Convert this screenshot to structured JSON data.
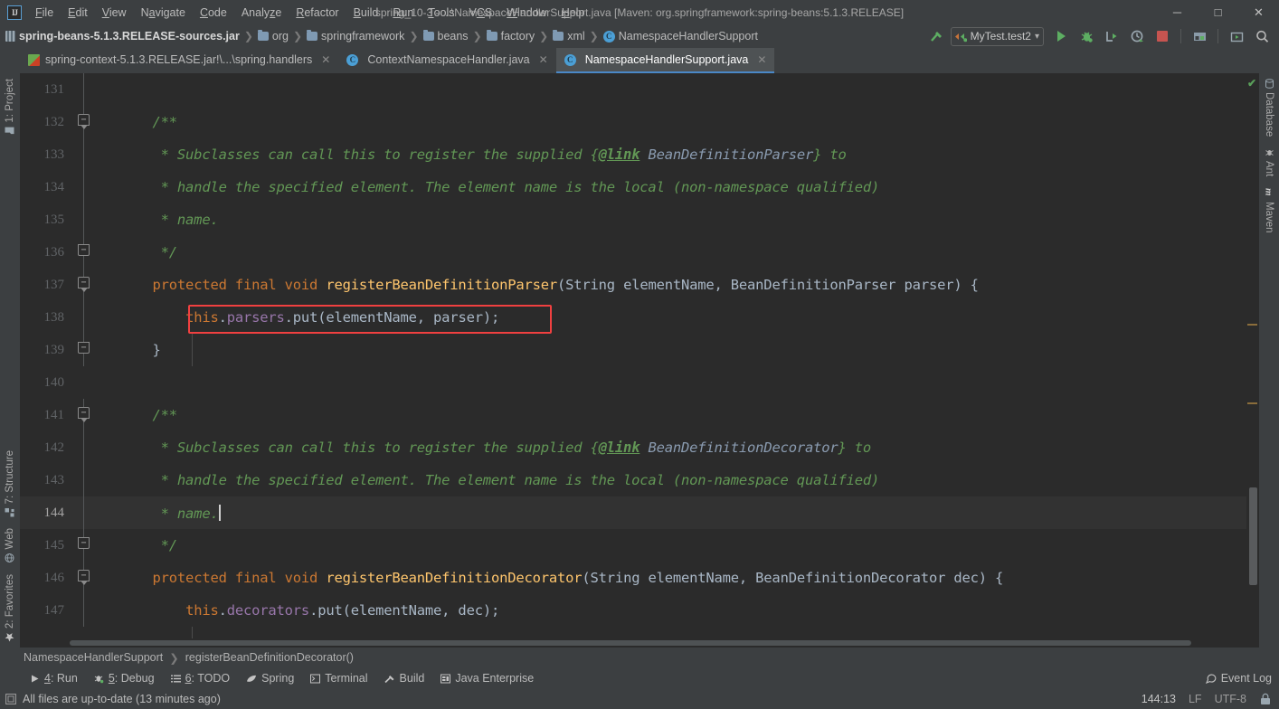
{
  "window": {
    "title": "spring_10-3 - ...\\NamespaceHandlerSupport.java [Maven: org.springframework:spring-beans:5.1.3.RELEASE]",
    "logo": "IJ",
    "minimize": "─",
    "maximize": "□",
    "close": "✕"
  },
  "menu": [
    {
      "label": "File"
    },
    {
      "label": "Edit"
    },
    {
      "label": "View"
    },
    {
      "label": "Navigate"
    },
    {
      "label": "Code"
    },
    {
      "label": "Analyze"
    },
    {
      "label": "Refactor"
    },
    {
      "label": "Build"
    },
    {
      "label": "Run"
    },
    {
      "label": "Tools"
    },
    {
      "label": "VCS"
    },
    {
      "label": "Window"
    },
    {
      "label": "Help"
    }
  ],
  "breadcrumb_top": [
    {
      "label": "spring-beans-5.1.3.RELEASE-sources.jar",
      "icon": "jar-icon"
    },
    {
      "label": "org",
      "icon": "folder-icon"
    },
    {
      "label": "springframework",
      "icon": "folder-icon"
    },
    {
      "label": "beans",
      "icon": "folder-icon"
    },
    {
      "label": "factory",
      "icon": "folder-icon"
    },
    {
      "label": "xml",
      "icon": "folder-icon"
    },
    {
      "label": "NamespaceHandlerSupport",
      "icon": "class-icon",
      "glyph": "C"
    }
  ],
  "toolbar_right": {
    "run_config": "MyTest.test2",
    "dropdown_glyph": "▾",
    "buttons": [
      {
        "name": "build-hammer-button"
      },
      {
        "name": "run-button"
      },
      {
        "name": "debug-button"
      },
      {
        "name": "run-with-coverage-button"
      },
      {
        "name": "profile-button"
      },
      {
        "name": "stop-button"
      },
      {
        "name": "project-structure-button"
      },
      {
        "name": "select-opened-file-button"
      },
      {
        "name": "search-everywhere-button"
      }
    ]
  },
  "tabs": [
    {
      "label": "spring-context-5.1.3.RELEASE.jar!\\...\\spring.handlers",
      "icon": "xml-file-icon",
      "active": false,
      "close": "✕"
    },
    {
      "label": "ContextNamespaceHandler.java",
      "icon": "class-icon",
      "glyph": "C",
      "active": false,
      "close": "✕"
    },
    {
      "label": "NamespaceHandlerSupport.java",
      "icon": "class-icon",
      "glyph": "C",
      "active": true,
      "close": "✕"
    }
  ],
  "left_bar": {
    "top": [
      {
        "label": "1: Project",
        "icon": "project-folder-icon"
      }
    ],
    "bottom": [
      {
        "label": "7: Structure",
        "icon": "structure-icon"
      },
      {
        "label": "Web",
        "icon": "web-globe-icon"
      },
      {
        "label": "2: Favorites",
        "icon": "star-icon"
      }
    ]
  },
  "right_bar": [
    {
      "label": "Database",
      "icon": "database-icon"
    },
    {
      "label": "Ant",
      "icon": "ant-icon"
    },
    {
      "label": "Maven",
      "icon": "maven-icon"
    }
  ],
  "editor": {
    "first_line": 131,
    "current_line": 144,
    "lines": [
      {
        "n": 131,
        "fold": "line",
        "tokens": []
      },
      {
        "n": 132,
        "fold": "top",
        "tokens": [
          {
            "t": "    ",
            "c": "txt"
          },
          {
            "t": "/**",
            "c": "cmt"
          }
        ]
      },
      {
        "n": 133,
        "fold": "line",
        "tokens": [
          {
            "t": "     * Subclasses can call this to register the supplied ",
            "c": "cmt"
          },
          {
            "t": "{",
            "c": "cmt"
          },
          {
            "t": "@link",
            "c": "lnk"
          },
          {
            "t": " ",
            "c": "cmt"
          },
          {
            "t": "BeanDefinitionParser",
            "c": "lnktgt"
          },
          {
            "t": "}",
            "c": "cmt"
          },
          {
            "t": " to",
            "c": "cmt"
          }
        ]
      },
      {
        "n": 134,
        "fold": "line",
        "tokens": [
          {
            "t": "     * handle the specified element. The element name is the local (non-namespace qualified)",
            "c": "cmt"
          }
        ]
      },
      {
        "n": 135,
        "fold": "line",
        "tokens": [
          {
            "t": "     * name.",
            "c": "cmt"
          }
        ]
      },
      {
        "n": 136,
        "fold": "bot",
        "tokens": [
          {
            "t": "     */",
            "c": "cmt"
          }
        ]
      },
      {
        "n": 137,
        "fold": "top",
        "tokens": [
          {
            "t": "    ",
            "c": "txt"
          },
          {
            "t": "protected final void ",
            "c": "kw"
          },
          {
            "t": "registerBeanDefinitionParser",
            "c": "mname"
          },
          {
            "t": "(String elementName, BeanDefinitionParser parser) {",
            "c": "txt"
          }
        ]
      },
      {
        "n": 138,
        "fold": "line",
        "tokens": [
          {
            "t": "        ",
            "c": "txt"
          },
          {
            "t": "this",
            "c": "kw"
          },
          {
            "t": ".",
            "c": "txt"
          },
          {
            "t": "parsers",
            "c": "fld"
          },
          {
            "t": ".put(elementName, parser);",
            "c": "txt"
          }
        ]
      },
      {
        "n": 139,
        "fold": "bot",
        "tokens": [
          {
            "t": "    }",
            "c": "txt"
          }
        ]
      },
      {
        "n": 140,
        "fold": "none",
        "tokens": []
      },
      {
        "n": 141,
        "fold": "top",
        "tokens": [
          {
            "t": "    ",
            "c": "txt"
          },
          {
            "t": "/**",
            "c": "cmt"
          }
        ]
      },
      {
        "n": 142,
        "fold": "line",
        "tokens": [
          {
            "t": "     * Subclasses can call this to register the supplied ",
            "c": "cmt"
          },
          {
            "t": "{",
            "c": "cmt"
          },
          {
            "t": "@link",
            "c": "lnk"
          },
          {
            "t": " ",
            "c": "cmt"
          },
          {
            "t": "BeanDefinitionDecorator",
            "c": "lnktgt"
          },
          {
            "t": "}",
            "c": "cmt"
          },
          {
            "t": " to",
            "c": "cmt"
          }
        ]
      },
      {
        "n": 143,
        "fold": "line",
        "tokens": [
          {
            "t": "     * handle the specified element. The element name is the local (non-namespace qualified)",
            "c": "cmt"
          }
        ]
      },
      {
        "n": 144,
        "fold": "line",
        "current": true,
        "cursor": true,
        "tokens": [
          {
            "t": "     * name.",
            "c": "cmt"
          }
        ]
      },
      {
        "n": 145,
        "fold": "bot",
        "tokens": [
          {
            "t": "     */",
            "c": "cmt"
          }
        ]
      },
      {
        "n": 146,
        "fold": "top",
        "tokens": [
          {
            "t": "    ",
            "c": "txt"
          },
          {
            "t": "protected final void ",
            "c": "kw"
          },
          {
            "t": "registerBeanDefinitionDecorator",
            "c": "mname"
          },
          {
            "t": "(String elementName, BeanDefinitionDecorator dec) {",
            "c": "txt"
          }
        ]
      },
      {
        "n": 147,
        "fold": "line",
        "tokens": [
          {
            "t": "        ",
            "c": "txt"
          },
          {
            "t": "this",
            "c": "kw"
          },
          {
            "t": ".",
            "c": "txt"
          },
          {
            "t": "decorators",
            "c": "fld"
          },
          {
            "t": ".put(elementName, dec);",
            "c": "txt"
          }
        ]
      }
    ],
    "highlight_box": {
      "line": 138,
      "color": "#f04040"
    },
    "inspection_status": "✔"
  },
  "breadcrumb_bottom": [
    {
      "label": "NamespaceHandlerSupport"
    },
    {
      "label": "registerBeanDefinitionDecorator()"
    }
  ],
  "tool_windows": [
    {
      "label": "4: Run",
      "icon": "run-icon"
    },
    {
      "label": "5: Debug",
      "icon": "debug-icon"
    },
    {
      "label": "6: TODO",
      "icon": "todo-icon"
    },
    {
      "label": "Spring",
      "icon": "spring-leaf-icon"
    },
    {
      "label": "Terminal",
      "icon": "terminal-icon"
    },
    {
      "label": "Build",
      "icon": "build-hammer-icon"
    },
    {
      "label": "Java Enterprise",
      "icon": "java-enterprise-icon"
    }
  ],
  "event_log": {
    "label": "Event Log",
    "icon": "event-log-icon"
  },
  "status": {
    "message": "All files are up-to-date (13 minutes ago)",
    "message_icon": "save-indicator-icon",
    "caret": "144:13",
    "line_separator": "LF",
    "encoding": "UTF-8",
    "lock_icon": "read-only-icon"
  },
  "colors": {
    "chrome": "#3c3f41",
    "editor_bg": "#2b2b2b",
    "current_line": "#323232",
    "accent_tab": "#4a88c7",
    "highlight_red": "#f04040",
    "comment_green": "#629755",
    "keyword_orange": "#cc7832",
    "method_yellow": "#ffc66d",
    "field_purple": "#9876aa",
    "text_gray": "#a9b7c6"
  }
}
